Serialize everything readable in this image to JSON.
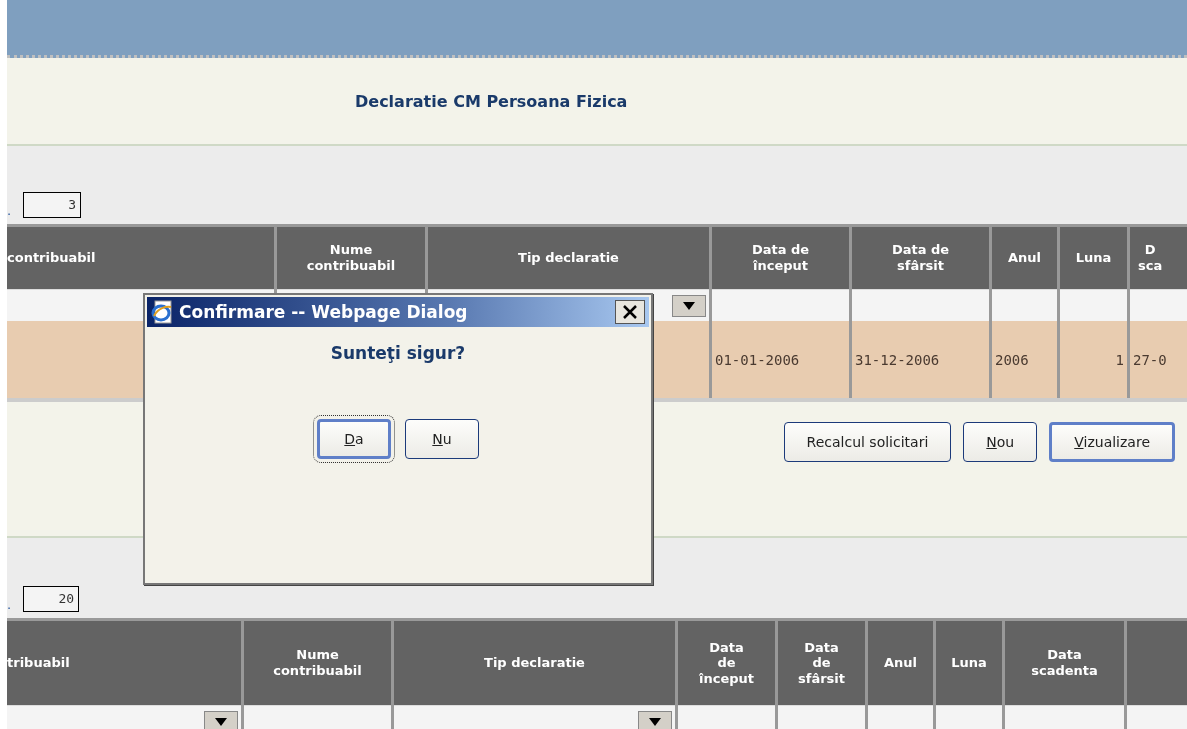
{
  "page_title": "Declaratie CM Persoana Fizica",
  "table1": {
    "label_fragment": ".",
    "page_size": "3",
    "columns": [
      {
        "label": "contribuabil",
        "kind": "text"
      },
      {
        "label": "Nume\ncontribuabil"
      },
      {
        "label": "Tip declaratie",
        "kind": "select"
      },
      {
        "label": "Data de\nînceput",
        "kind": "text"
      },
      {
        "label": "Data de\nsfârsit",
        "kind": "text"
      },
      {
        "label": "Anul",
        "kind": "text"
      },
      {
        "label": "Luna",
        "kind": "text"
      },
      {
        "label": "D\nsca",
        "kind": "text"
      }
    ],
    "rows": [
      {
        "selected": true,
        "cells": [
          null,
          null,
          null,
          "01-01-2006",
          "31-12-2006",
          "2006",
          "1",
          "27-0"
        ]
      }
    ]
  },
  "actions": [
    {
      "label": "Recalcul solicitari",
      "underline_first": false,
      "focused": false
    },
    {
      "label": "Nou",
      "underline_first": true,
      "focused": false
    },
    {
      "label": "Vizualizare",
      "underline_first": true,
      "focused": true
    }
  ],
  "table2": {
    "label_fragment": ".",
    "page_size": "20",
    "columns": [
      {
        "label": "tribuabil",
        "kind": "select"
      },
      {
        "label": "Nume\ncontribuabil",
        "kind": "text"
      },
      {
        "label": "Tip declaratie",
        "kind": "select"
      },
      {
        "label": "Data\nde\nînceput",
        "kind": "text"
      },
      {
        "label": "Data\nde\nsfârsit",
        "kind": "text"
      },
      {
        "label": "Anul",
        "kind": "text"
      },
      {
        "label": "Luna",
        "kind": "text"
      },
      {
        "label": "Data\nscadenta",
        "kind": "text"
      },
      {
        "kind": "text"
      }
    ]
  },
  "dialog": {
    "title": "Confirmare -- Webpage Dialog",
    "message": "Sunteţi sigur?",
    "buttons": [
      {
        "label": "Da",
        "underline_first": true,
        "selected": true
      },
      {
        "label": "Nu",
        "underline_first": true,
        "selected": false
      }
    ]
  }
}
